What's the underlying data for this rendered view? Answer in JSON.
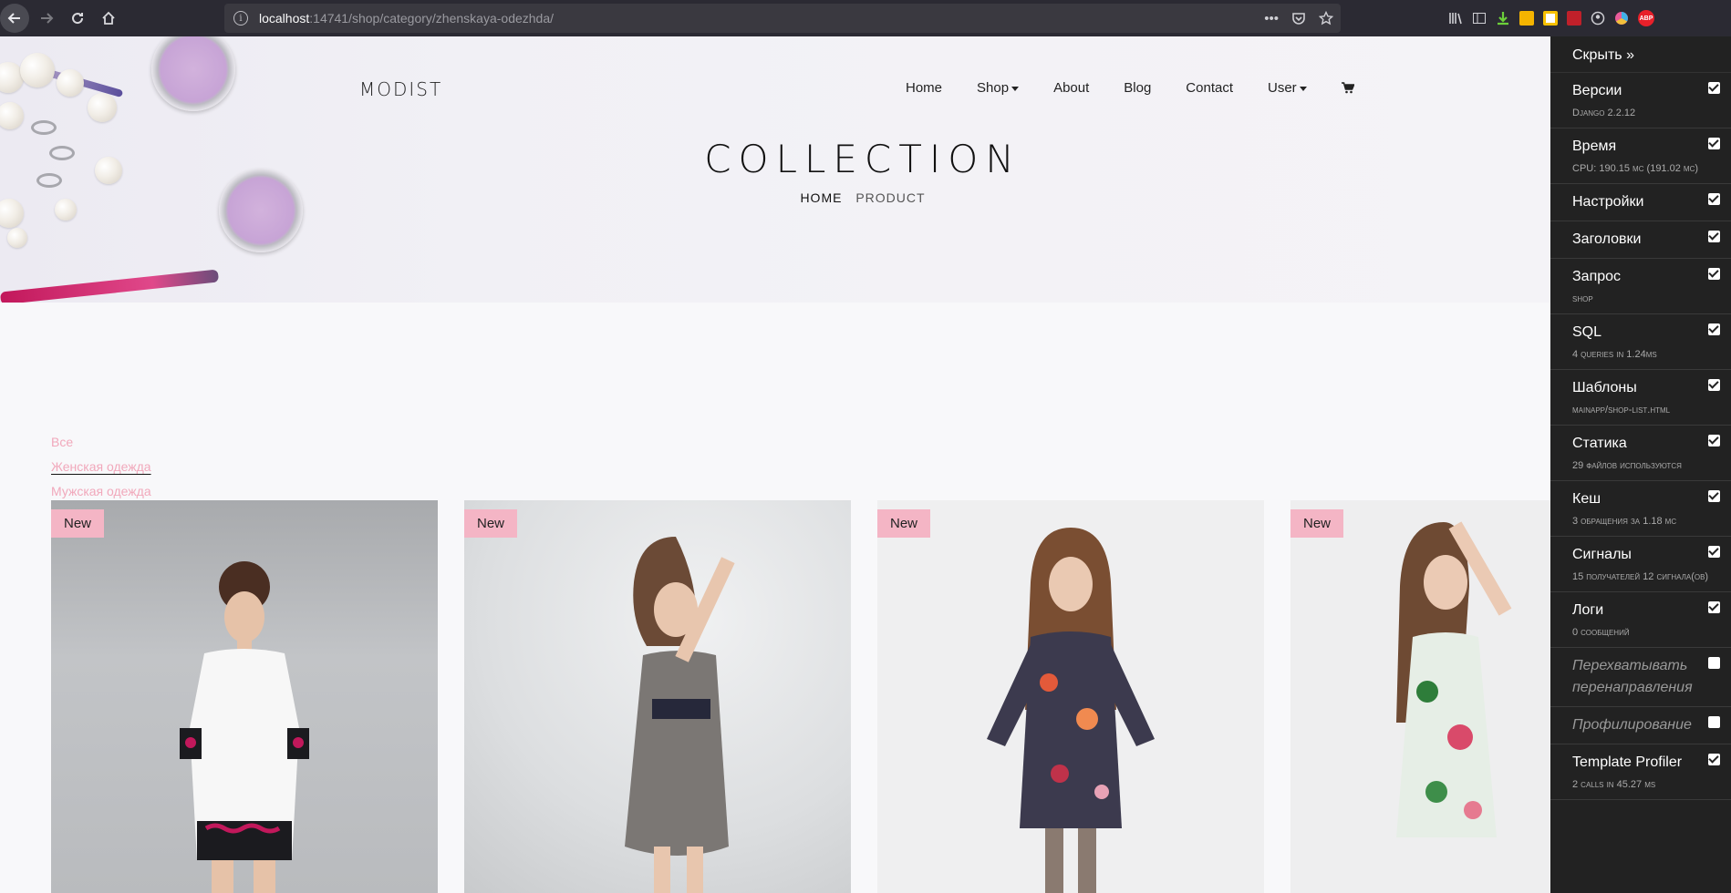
{
  "browser": {
    "url_host": "localhost",
    "url_rest": ":14741/shop/category/zhenskaya-odezhda/",
    "actions": [
      "•••",
      "pocket-icon",
      "star-icon"
    ],
    "extensions": [
      "library-icon",
      "sidebar-icon",
      "download-icon",
      "ext-yellow-icon",
      "ext-note-icon",
      "ext-red-icon",
      "account-icon",
      "color-icon",
      "adblock-icon"
    ]
  },
  "site": {
    "brand": "MODIST",
    "nav": [
      "Home",
      "Shop",
      "About",
      "Blog",
      "Contact",
      "User"
    ],
    "hero_title": "COLLECTION",
    "breadcrumbs": [
      "HOME",
      "PRODUCT"
    ]
  },
  "categories": [
    {
      "label": "Все",
      "active": false
    },
    {
      "label": "Женская одежда",
      "active": true
    },
    {
      "label": "Мужская одежда",
      "active": false
    }
  ],
  "products": [
    {
      "badge": "New"
    },
    {
      "badge": "New"
    },
    {
      "badge": "New"
    },
    {
      "badge": "New"
    }
  ],
  "debug_toolbar": {
    "hide_label": "Скрыть »",
    "panels": [
      {
        "title": "Версии",
        "sub": "Django 2.2.12",
        "checked": true,
        "italic": false
      },
      {
        "title": "Время",
        "sub": "CPU: 190.15 мс (191.02 мс)",
        "checked": true,
        "italic": false
      },
      {
        "title": "Настройки",
        "sub": "",
        "checked": true,
        "italic": false
      },
      {
        "title": "Заголовки",
        "sub": "",
        "checked": true,
        "italic": false
      },
      {
        "title": "Запрос",
        "sub": "shop",
        "checked": true,
        "italic": false
      },
      {
        "title": "SQL",
        "sub": "4 queries in 1.24ms",
        "checked": true,
        "italic": false
      },
      {
        "title": "Шаблоны",
        "sub": "mainapp/shop-list.html",
        "checked": true,
        "italic": false
      },
      {
        "title": "Статика",
        "sub": "29 файлов используются",
        "checked": true,
        "italic": false
      },
      {
        "title": "Кеш",
        "sub": "3 обращения за 1.18 мс",
        "checked": true,
        "italic": false
      },
      {
        "title": "Сигналы",
        "sub": "15 получателей 12 сигнала(ов)",
        "checked": true,
        "italic": false
      },
      {
        "title": "Логи",
        "sub": "0 сообщений",
        "checked": true,
        "italic": false
      },
      {
        "title": "Перехватывать перенаправления",
        "sub": "",
        "checked": false,
        "italic": true
      },
      {
        "title": "Профилирование",
        "sub": "",
        "checked": false,
        "italic": true
      },
      {
        "title": "Template Profiler",
        "sub": "2 calls in 45.27 ms",
        "checked": true,
        "italic": false
      }
    ]
  },
  "colors": {
    "accent_pink": "#f4b5c5",
    "category_link": "#f1a8bb",
    "toolbar_bg": "#222222"
  }
}
